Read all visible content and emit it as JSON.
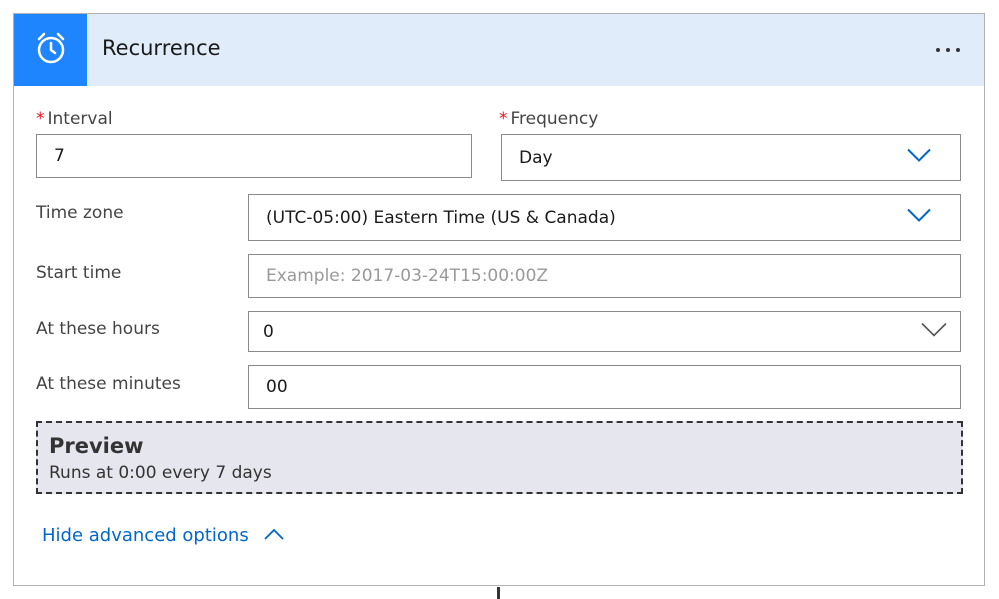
{
  "header": {
    "title": "Recurrence",
    "icon": "alarm-clock-icon",
    "more_icon": "ellipsis-icon",
    "accent_color": "#1f85ff",
    "header_bg": "#e1ecfa"
  },
  "form": {
    "interval": {
      "required_mark": "*",
      "label": "Interval",
      "value": "7"
    },
    "frequency": {
      "required_mark": "*",
      "label": "Frequency",
      "value": "Day"
    },
    "time_zone": {
      "label": "Time zone",
      "value": "(UTC-05:00) Eastern Time (US & Canada)"
    },
    "start_time": {
      "label": "Start time",
      "value": "",
      "placeholder": "Example: 2017-03-24T15:00:00Z"
    },
    "at_these_hours": {
      "label": "At these hours",
      "value": "0"
    },
    "at_these_minutes": {
      "label": "At these minutes",
      "value": "00"
    }
  },
  "preview": {
    "title": "Preview",
    "text": "Runs at 0:00 every 7 days"
  },
  "advanced": {
    "toggle_label": "Hide advanced options",
    "link_color": "#0066cc"
  }
}
